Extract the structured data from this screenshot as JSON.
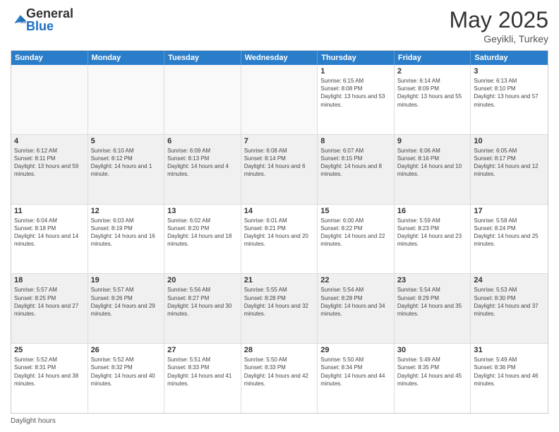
{
  "logo": {
    "general": "General",
    "blue": "Blue"
  },
  "title": {
    "month_year": "May 2025",
    "location": "Geyikli, Turkey"
  },
  "header_days": [
    "Sunday",
    "Monday",
    "Tuesday",
    "Wednesday",
    "Thursday",
    "Friday",
    "Saturday"
  ],
  "footer": {
    "daylight_label": "Daylight hours"
  },
  "weeks": [
    [
      {
        "day": "",
        "sunrise": "",
        "sunset": "",
        "daylight": "",
        "empty": true
      },
      {
        "day": "",
        "sunrise": "",
        "sunset": "",
        "daylight": "",
        "empty": true
      },
      {
        "day": "",
        "sunrise": "",
        "sunset": "",
        "daylight": "",
        "empty": true
      },
      {
        "day": "",
        "sunrise": "",
        "sunset": "",
        "daylight": "",
        "empty": true
      },
      {
        "day": "1",
        "sunrise": "Sunrise: 6:15 AM",
        "sunset": "Sunset: 8:08 PM",
        "daylight": "Daylight: 13 hours and 53 minutes.",
        "empty": false
      },
      {
        "day": "2",
        "sunrise": "Sunrise: 6:14 AM",
        "sunset": "Sunset: 8:09 PM",
        "daylight": "Daylight: 13 hours and 55 minutes.",
        "empty": false
      },
      {
        "day": "3",
        "sunrise": "Sunrise: 6:13 AM",
        "sunset": "Sunset: 8:10 PM",
        "daylight": "Daylight: 13 hours and 57 minutes.",
        "empty": false
      }
    ],
    [
      {
        "day": "4",
        "sunrise": "Sunrise: 6:12 AM",
        "sunset": "Sunset: 8:11 PM",
        "daylight": "Daylight: 13 hours and 59 minutes.",
        "empty": false
      },
      {
        "day": "5",
        "sunrise": "Sunrise: 6:10 AM",
        "sunset": "Sunset: 8:12 PM",
        "daylight": "Daylight: 14 hours and 1 minute.",
        "empty": false
      },
      {
        "day": "6",
        "sunrise": "Sunrise: 6:09 AM",
        "sunset": "Sunset: 8:13 PM",
        "daylight": "Daylight: 14 hours and 4 minutes.",
        "empty": false
      },
      {
        "day": "7",
        "sunrise": "Sunrise: 6:08 AM",
        "sunset": "Sunset: 8:14 PM",
        "daylight": "Daylight: 14 hours and 6 minutes.",
        "empty": false
      },
      {
        "day": "8",
        "sunrise": "Sunrise: 6:07 AM",
        "sunset": "Sunset: 8:15 PM",
        "daylight": "Daylight: 14 hours and 8 minutes.",
        "empty": false
      },
      {
        "day": "9",
        "sunrise": "Sunrise: 6:06 AM",
        "sunset": "Sunset: 8:16 PM",
        "daylight": "Daylight: 14 hours and 10 minutes.",
        "empty": false
      },
      {
        "day": "10",
        "sunrise": "Sunrise: 6:05 AM",
        "sunset": "Sunset: 8:17 PM",
        "daylight": "Daylight: 14 hours and 12 minutes.",
        "empty": false
      }
    ],
    [
      {
        "day": "11",
        "sunrise": "Sunrise: 6:04 AM",
        "sunset": "Sunset: 8:18 PM",
        "daylight": "Daylight: 14 hours and 14 minutes.",
        "empty": false
      },
      {
        "day": "12",
        "sunrise": "Sunrise: 6:03 AM",
        "sunset": "Sunset: 8:19 PM",
        "daylight": "Daylight: 14 hours and 16 minutes.",
        "empty": false
      },
      {
        "day": "13",
        "sunrise": "Sunrise: 6:02 AM",
        "sunset": "Sunset: 8:20 PM",
        "daylight": "Daylight: 14 hours and 18 minutes.",
        "empty": false
      },
      {
        "day": "14",
        "sunrise": "Sunrise: 6:01 AM",
        "sunset": "Sunset: 8:21 PM",
        "daylight": "Daylight: 14 hours and 20 minutes.",
        "empty": false
      },
      {
        "day": "15",
        "sunrise": "Sunrise: 6:00 AM",
        "sunset": "Sunset: 8:22 PM",
        "daylight": "Daylight: 14 hours and 22 minutes.",
        "empty": false
      },
      {
        "day": "16",
        "sunrise": "Sunrise: 5:59 AM",
        "sunset": "Sunset: 8:23 PM",
        "daylight": "Daylight: 14 hours and 23 minutes.",
        "empty": false
      },
      {
        "day": "17",
        "sunrise": "Sunrise: 5:58 AM",
        "sunset": "Sunset: 8:24 PM",
        "daylight": "Daylight: 14 hours and 25 minutes.",
        "empty": false
      }
    ],
    [
      {
        "day": "18",
        "sunrise": "Sunrise: 5:57 AM",
        "sunset": "Sunset: 8:25 PM",
        "daylight": "Daylight: 14 hours and 27 minutes.",
        "empty": false
      },
      {
        "day": "19",
        "sunrise": "Sunrise: 5:57 AM",
        "sunset": "Sunset: 8:26 PM",
        "daylight": "Daylight: 14 hours and 29 minutes.",
        "empty": false
      },
      {
        "day": "20",
        "sunrise": "Sunrise: 5:56 AM",
        "sunset": "Sunset: 8:27 PM",
        "daylight": "Daylight: 14 hours and 30 minutes.",
        "empty": false
      },
      {
        "day": "21",
        "sunrise": "Sunrise: 5:55 AM",
        "sunset": "Sunset: 8:28 PM",
        "daylight": "Daylight: 14 hours and 32 minutes.",
        "empty": false
      },
      {
        "day": "22",
        "sunrise": "Sunrise: 5:54 AM",
        "sunset": "Sunset: 8:28 PM",
        "daylight": "Daylight: 14 hours and 34 minutes.",
        "empty": false
      },
      {
        "day": "23",
        "sunrise": "Sunrise: 5:54 AM",
        "sunset": "Sunset: 8:29 PM",
        "daylight": "Daylight: 14 hours and 35 minutes.",
        "empty": false
      },
      {
        "day": "24",
        "sunrise": "Sunrise: 5:53 AM",
        "sunset": "Sunset: 8:30 PM",
        "daylight": "Daylight: 14 hours and 37 minutes.",
        "empty": false
      }
    ],
    [
      {
        "day": "25",
        "sunrise": "Sunrise: 5:52 AM",
        "sunset": "Sunset: 8:31 PM",
        "daylight": "Daylight: 14 hours and 38 minutes.",
        "empty": false
      },
      {
        "day": "26",
        "sunrise": "Sunrise: 5:52 AM",
        "sunset": "Sunset: 8:32 PM",
        "daylight": "Daylight: 14 hours and 40 minutes.",
        "empty": false
      },
      {
        "day": "27",
        "sunrise": "Sunrise: 5:51 AM",
        "sunset": "Sunset: 8:33 PM",
        "daylight": "Daylight: 14 hours and 41 minutes.",
        "empty": false
      },
      {
        "day": "28",
        "sunrise": "Sunrise: 5:50 AM",
        "sunset": "Sunset: 8:33 PM",
        "daylight": "Daylight: 14 hours and 42 minutes.",
        "empty": false
      },
      {
        "day": "29",
        "sunrise": "Sunrise: 5:50 AM",
        "sunset": "Sunset: 8:34 PM",
        "daylight": "Daylight: 14 hours and 44 minutes.",
        "empty": false
      },
      {
        "day": "30",
        "sunrise": "Sunrise: 5:49 AM",
        "sunset": "Sunset: 8:35 PM",
        "daylight": "Daylight: 14 hours and 45 minutes.",
        "empty": false
      },
      {
        "day": "31",
        "sunrise": "Sunrise: 5:49 AM",
        "sunset": "Sunset: 8:36 PM",
        "daylight": "Daylight: 14 hours and 46 minutes.",
        "empty": false
      }
    ]
  ]
}
